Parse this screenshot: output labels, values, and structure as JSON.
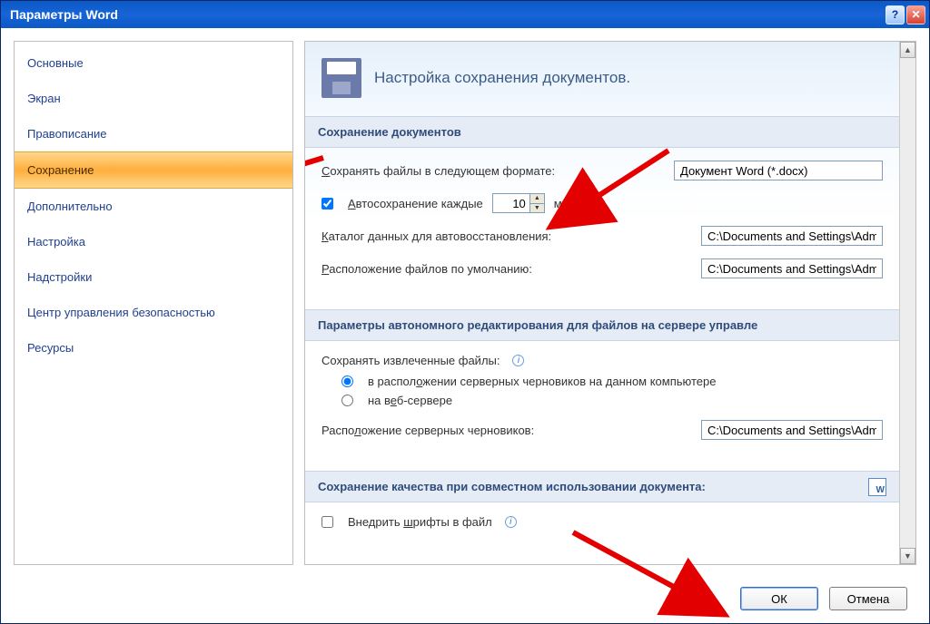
{
  "window": {
    "title": "Параметры Word"
  },
  "sidebar": {
    "items": [
      "Основные",
      "Экран",
      "Правописание",
      "Сохранение",
      "Дополнительно",
      "Настройка",
      "Надстройки",
      "Центр управления безопасностью",
      "Ресурсы"
    ],
    "selected_index": 3
  },
  "page": {
    "title": "Настройка сохранения документов."
  },
  "section_save": {
    "title": "Сохранение документов",
    "format_label": "Сохранять файлы в следующем формате:",
    "format_value": "Документ Word (*.docx)",
    "autosave_label": "Автосохранение каждые",
    "autosave_value": "10",
    "autosave_unit": "минут",
    "autosave_checked": true,
    "recovery_label": "Каталог данных для автовосстановления:",
    "recovery_value": "C:\\Documents and Settings\\Admi",
    "default_loc_label": "Расположение файлов по умолчанию:",
    "default_loc_value": "C:\\Documents and Settings\\Admi"
  },
  "section_offline": {
    "title": "Параметры автономного редактирования для файлов на сервере управле",
    "extracted_label": "Сохранять извлеченные файлы:",
    "option_local": "в расположении серверных черновиков на данном компьютере",
    "option_web": "на веб-сервере",
    "selected_option": "local",
    "drafts_label": "Расположение серверных черновиков:",
    "drafts_value": "C:\\Documents and Settings\\Admin\\"
  },
  "section_quality": {
    "title": "Сохранение качества при совместном использовании документа:",
    "embed_label": "Внедрить шрифты в файл",
    "embed_checked": false
  },
  "buttons": {
    "ok": "ОК",
    "cancel": "Отмена"
  }
}
